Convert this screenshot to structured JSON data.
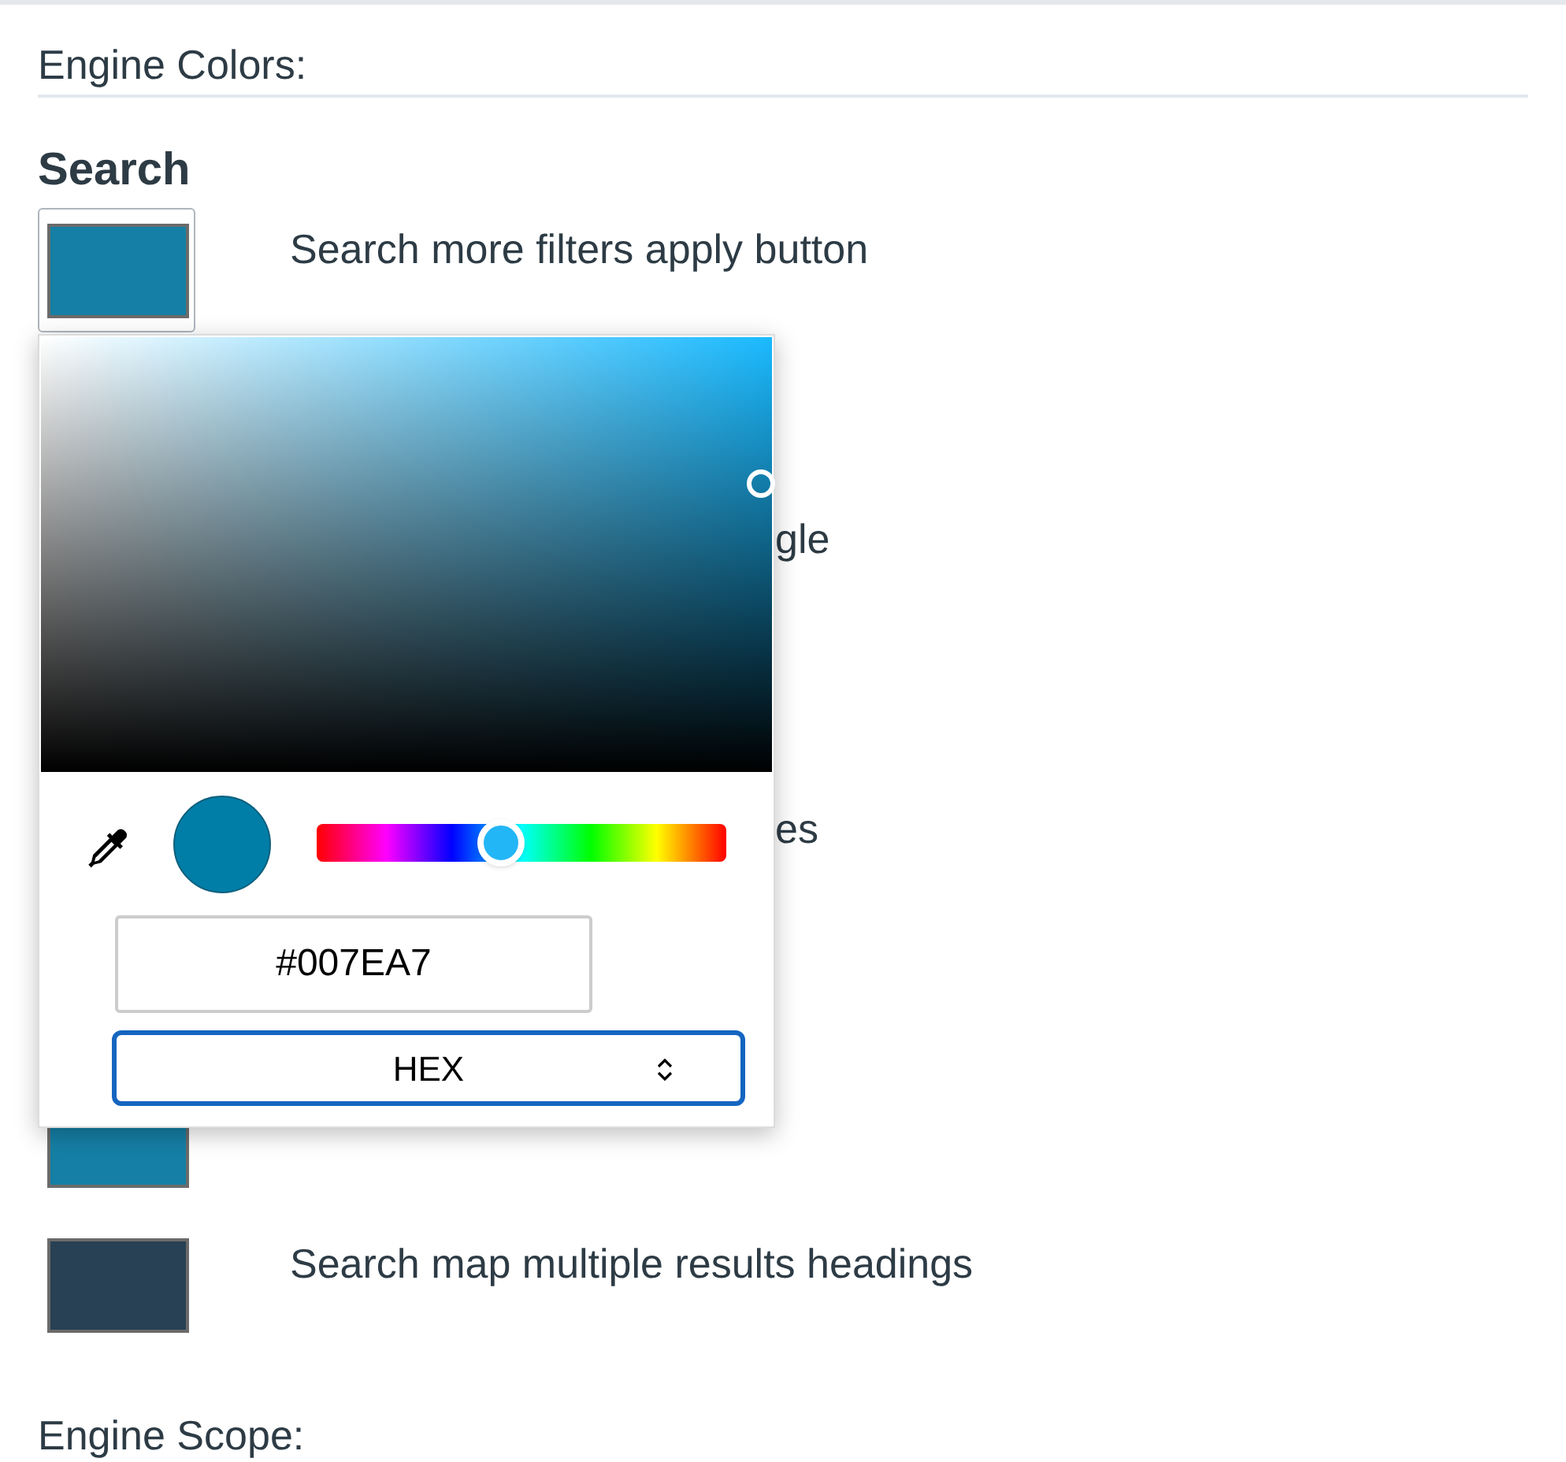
{
  "section_title": "Engine Colors:",
  "group_heading": "Search",
  "rows": [
    {
      "kind": "focused",
      "label": "Search more filters apply button",
      "color": "#157fa5"
    },
    {
      "kind": "tail",
      "label": "gle"
    },
    {
      "kind": "tail",
      "label": "es"
    },
    {
      "kind": "covered",
      "color": "#157fa5"
    },
    {
      "kind": "swatch",
      "label": "Search map multiple results headings",
      "color": "#284154"
    }
  ],
  "color_picker": {
    "hue": {
      "level": 0.45
    },
    "value": "#007EA7",
    "format": {
      "value": "HEX",
      "focused": true
    }
  },
  "next_section_title": "Engine Scope:"
}
